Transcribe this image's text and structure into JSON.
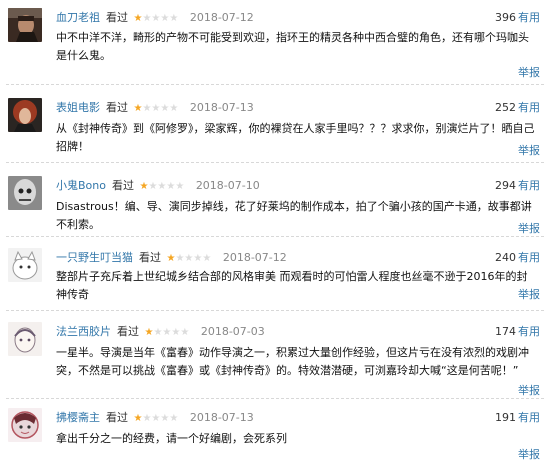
{
  "labels": {
    "action": "看过",
    "useful_word": "有用",
    "report": "举报"
  },
  "colors": {
    "link": "#3377aa",
    "star": "#f5a623",
    "star_off": "#dcdcdc",
    "date": "#888888"
  },
  "reviews": [
    {
      "author": "血刀老祖",
      "rating": 1,
      "max_rating": 5,
      "date": "2018-07-12",
      "useful": "396",
      "content": "中不中洋不洋，畸形的产物不可能受到欢迎，指环王的精灵各种中西合璧的角色，还有哪个玛咖头是什么鬼。",
      "avatar": "dark-portrait"
    },
    {
      "author": "表姐电影",
      "rating": 1,
      "max_rating": 5,
      "date": "2018-07-13",
      "useful": "252",
      "content": "从《封神传奇》到《阿修罗》，梁家辉，你的裸贷在人家手里吗？？？求求你，别演烂片了！晒自己招牌！",
      "avatar": "red-hair-portrait"
    },
    {
      "author": "小鬼Bono",
      "rating": 1,
      "max_rating": 5,
      "date": "2018-07-10",
      "useful": "294",
      "content": "Disastrous！编、导、演同步掉线，花了好莱坞的制作成本，拍了个骗小孩的国产卡通，故事都讲不利索。",
      "avatar": "bw-portrait"
    },
    {
      "author": "一只野生叮当猫",
      "rating": 1,
      "max_rating": 5,
      "date": "2018-07-12",
      "useful": "240",
      "content": "整部片子充斥着上世纪城乡结合部的风格审美 而观看时的可怕雷人程度也丝毫不逊于2016年的封神传奇",
      "avatar": "white-cat-portrait"
    },
    {
      "author": "法兰西胶片",
      "rating": 1,
      "max_rating": 5,
      "date": "2018-07-03",
      "useful": "174",
      "content": "一星半。导演是当年《富春》动作导演之一，积累过大量创作经验，但这片亏在没有浓烈的戏剧冲突，不然是可以挑战《富春》或《封神传奇》的。特效潜潜硬，可浏嘉玲却大喊“这是何苦呢！”",
      "avatar": "sketch-portrait"
    },
    {
      "author": "拂樱斋主",
      "rating": 1,
      "max_rating": 5,
      "date": "2018-07-13",
      "useful": "191",
      "content": "拿出千分之一的经费，请一个好编剧，会死系列",
      "avatar": "anime-portrait"
    }
  ]
}
